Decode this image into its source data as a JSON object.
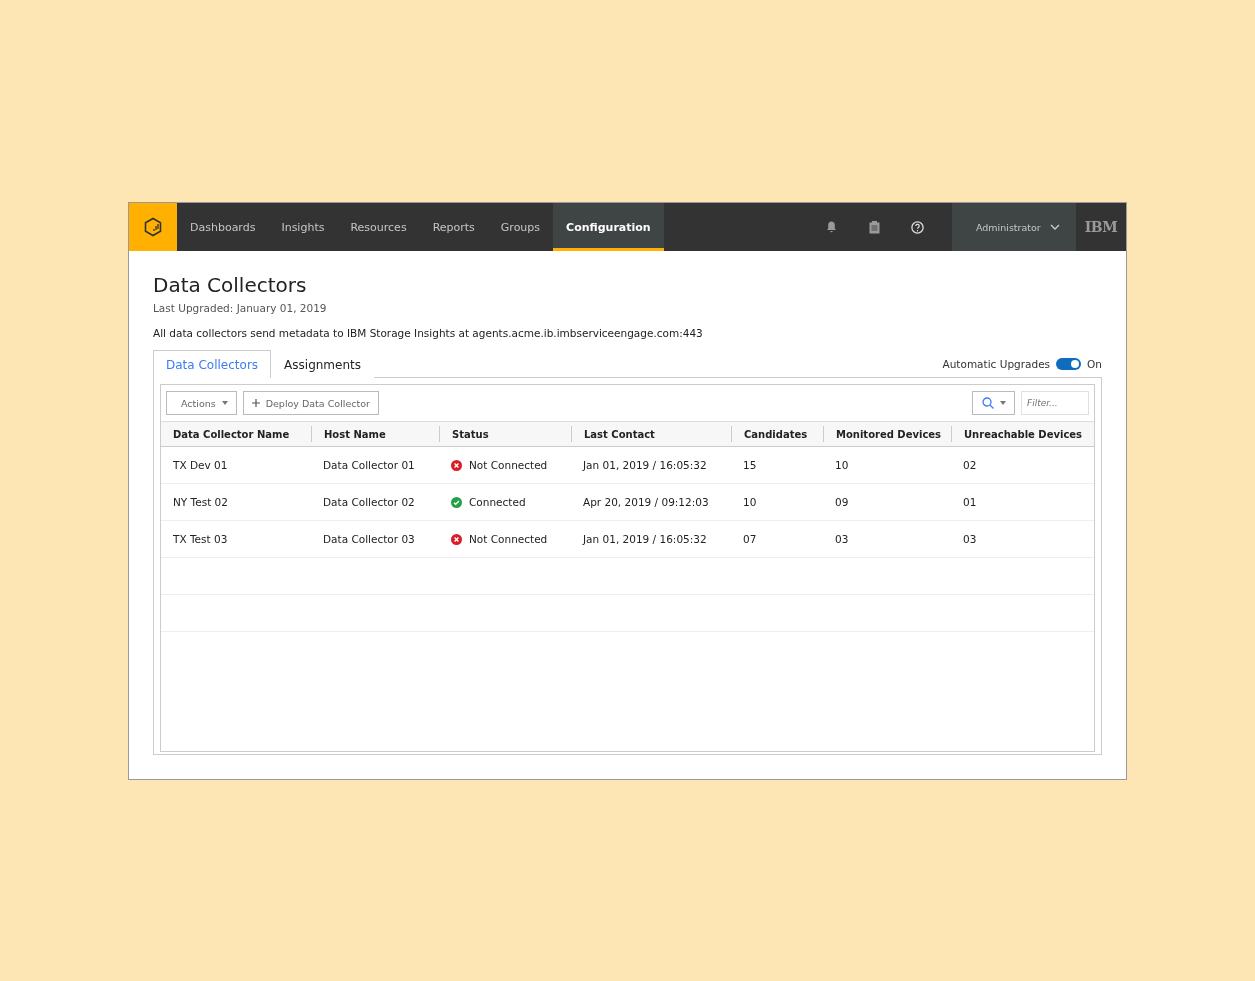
{
  "nav": {
    "items": [
      {
        "label": "Dashboards",
        "selected": false
      },
      {
        "label": "Insights",
        "selected": false
      },
      {
        "label": "Resources",
        "selected": false
      },
      {
        "label": "Reports",
        "selected": false
      },
      {
        "label": "Groups",
        "selected": false
      },
      {
        "label": "Configuration",
        "selected": true
      }
    ],
    "user": "Administrator",
    "brand": "IBM"
  },
  "page": {
    "title": "Data Collectors",
    "subtitle": "Last Upgraded: January 01, 2019",
    "description": "All data collectors send metadata to IBM Storage Insights at agents.acme.ib.imbserviceengage.com:443"
  },
  "tabs": [
    {
      "label": "Data Collectors",
      "selected": true
    },
    {
      "label": "Assignments",
      "selected": false
    }
  ],
  "auto_upgrades": {
    "label": "Automatic Upgrades",
    "on": true,
    "state_text": "On"
  },
  "toolbar": {
    "actions": "Actions",
    "deploy": "Deploy Data Collector",
    "filter_placeholder": "Filter..."
  },
  "table": {
    "columns": [
      "Data Collector Name",
      "Host Name",
      "Status",
      "Last Contact",
      "Candidates",
      "Monitored Devices",
      "Unreachable Devices"
    ],
    "rows": [
      {
        "name": "TX Dev 01",
        "host": "Data Collector 01",
        "status": "Not Connected",
        "kind": "error",
        "last_contact": "Jan 01, 2019 / 16:05:32",
        "candidates": "15",
        "monitored": "10",
        "unreachable": "02"
      },
      {
        "name": "NY Test 02",
        "host": "Data Collector 02",
        "status": "Connected",
        "kind": "ok",
        "last_contact": "Apr 20, 2019 / 09:12:03",
        "candidates": "10",
        "monitored": "09",
        "unreachable": "01"
      },
      {
        "name": "TX Test 03",
        "host": "Data Collector 03",
        "status": "Not Connected",
        "kind": "error",
        "last_contact": "Jan 01, 2019 / 16:05:32",
        "candidates": "07",
        "monitored": "03",
        "unreachable": "03"
      }
    ]
  }
}
